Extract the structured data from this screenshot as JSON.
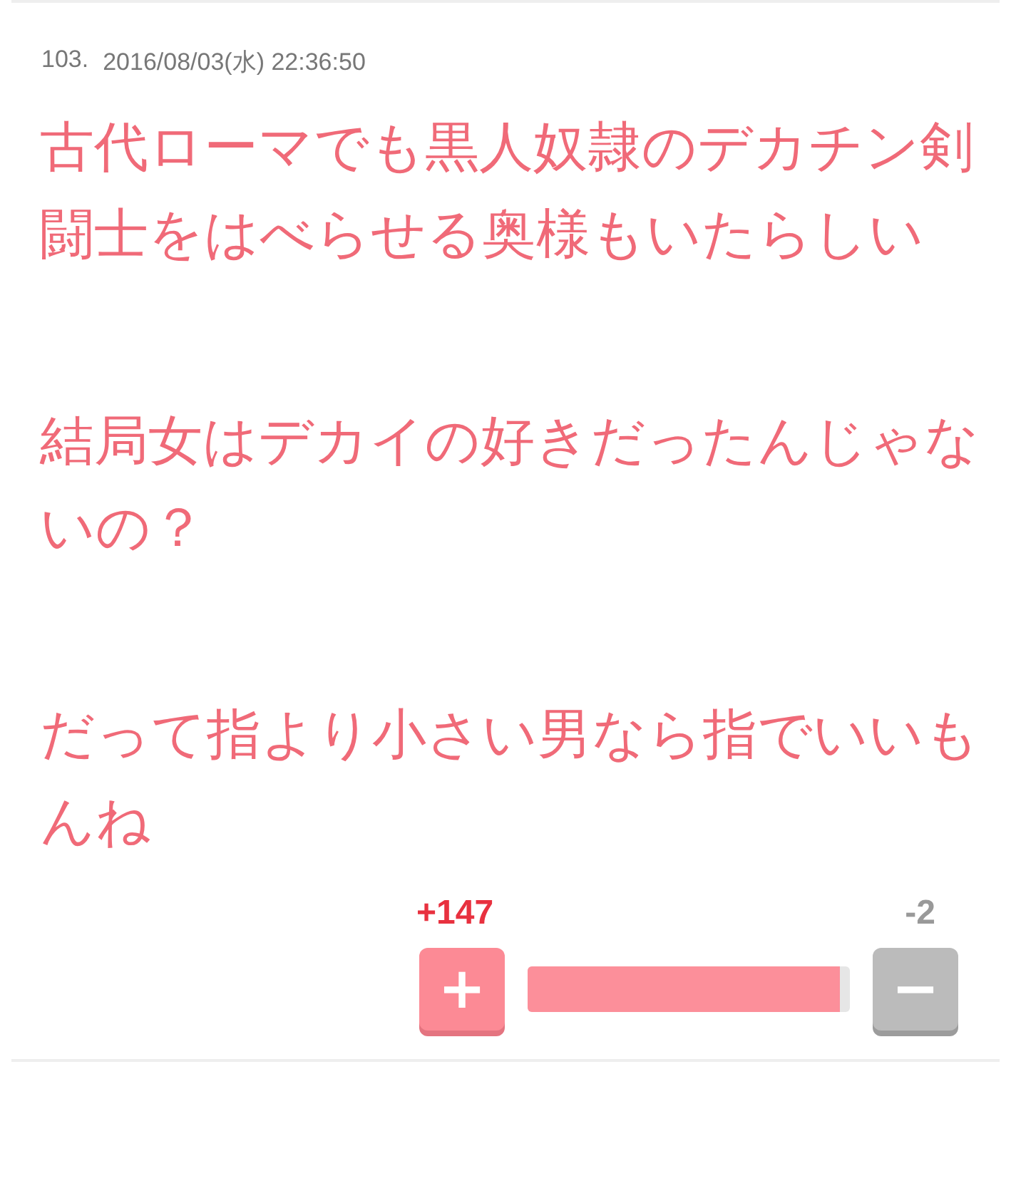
{
  "comment": {
    "number": "103.",
    "date": "2016/08/03(水) 22:36:50",
    "paragraphs": [
      "古代ローマでも黒人奴隷のデカチン剣闘士をはべらせる奥様もいたらしい",
      "結局女はデカイの好きだったんじゃないの？",
      "だって指より小さい男なら指でいいもんね"
    ]
  },
  "votes": {
    "plus": "+147",
    "minus": "-2",
    "plus_symbol": "+",
    "minus_symbol": "−",
    "level": 0.97
  }
}
